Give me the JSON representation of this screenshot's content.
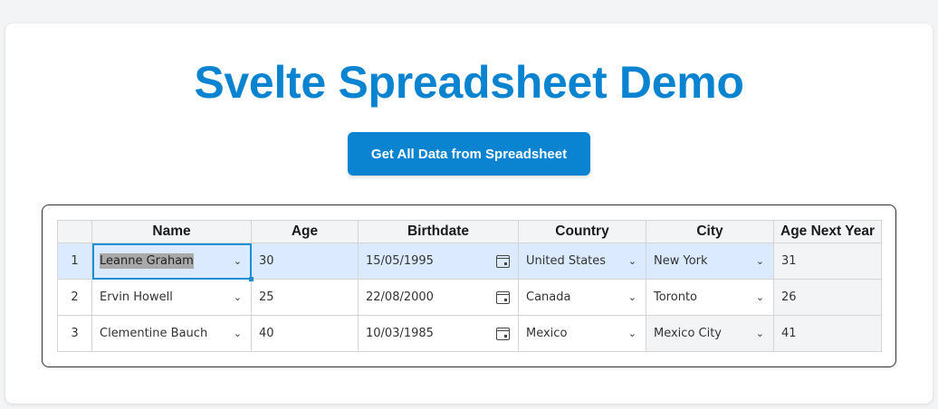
{
  "page": {
    "title": "Svelte Spreadsheet Demo"
  },
  "actions": {
    "get_all_label": "Get All Data from Spreadsheet"
  },
  "sheet": {
    "columns": [
      "Name",
      "Age",
      "Birthdate",
      "Country",
      "City",
      "Age Next Year"
    ],
    "rows": [
      {
        "num": "1",
        "name": "Leanne Graham",
        "age": "30",
        "birthdate": "15/05/1995",
        "country": "United States",
        "city": "New York",
        "age_next": "31"
      },
      {
        "num": "2",
        "name": "Ervin Howell",
        "age": "25",
        "birthdate": "22/08/2000",
        "country": "Canada",
        "city": "Toronto",
        "age_next": "26"
      },
      {
        "num": "3",
        "name": "Clementine Bauch",
        "age": "40",
        "birthdate": "10/03/1985",
        "country": "Mexico",
        "city": "Mexico City",
        "age_next": "41"
      }
    ]
  },
  "colors": {
    "accent": "#0a84d0",
    "selected_row": "#dbeafe",
    "header_bg": "#f3f4f6",
    "active_outline": "#1a8fd6"
  }
}
